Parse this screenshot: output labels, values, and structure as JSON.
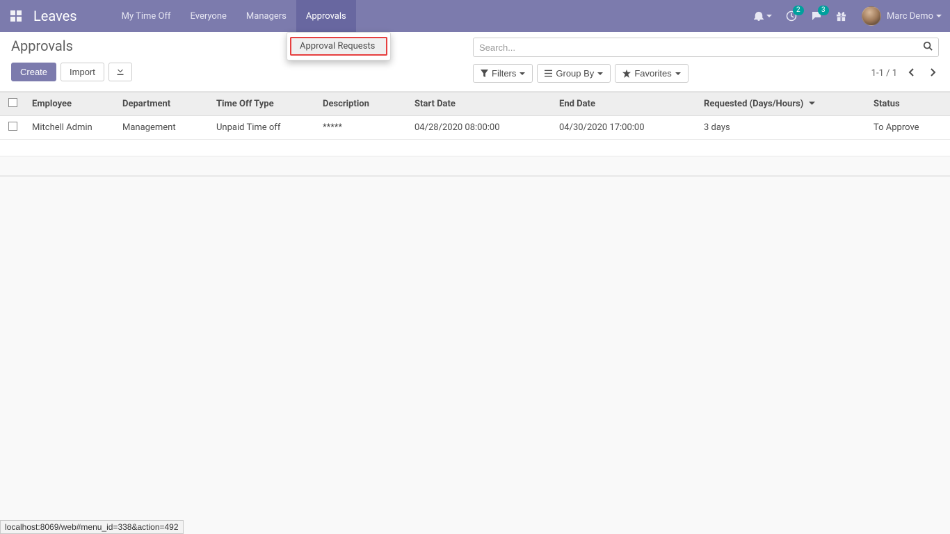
{
  "navbar": {
    "brand": "Leaves",
    "menu": [
      {
        "label": "My Time Off",
        "active": false
      },
      {
        "label": "Everyone",
        "active": false
      },
      {
        "label": "Managers",
        "active": false
      },
      {
        "label": "Approvals",
        "active": true
      }
    ],
    "badges": {
      "activities": "2",
      "messages": "3"
    },
    "user": "Marc Demo"
  },
  "dropdown": {
    "items": [
      "Approval Requests"
    ]
  },
  "page": {
    "title": "Approvals",
    "buttons": {
      "create": "Create",
      "import": "Import"
    }
  },
  "search": {
    "placeholder": "Search..."
  },
  "toolbar": {
    "filters": "Filters",
    "group_by": "Group By",
    "favorites": "Favorites",
    "pager": "1-1 / 1"
  },
  "table": {
    "headers": {
      "employee": "Employee",
      "department": "Department",
      "type": "Time Off Type",
      "description": "Description",
      "start": "Start Date",
      "end": "End Date",
      "requested": "Requested (Days/Hours)",
      "status": "Status"
    },
    "rows": [
      {
        "employee": "Mitchell Admin",
        "department": "Management",
        "type": "Unpaid Time off",
        "description": "*****",
        "start": "04/28/2020 08:00:00",
        "end": "04/30/2020 17:00:00",
        "requested": "3 days",
        "status": "To Approve"
      }
    ]
  },
  "statusbar": "localhost:8069/web#menu_id=338&action=492"
}
